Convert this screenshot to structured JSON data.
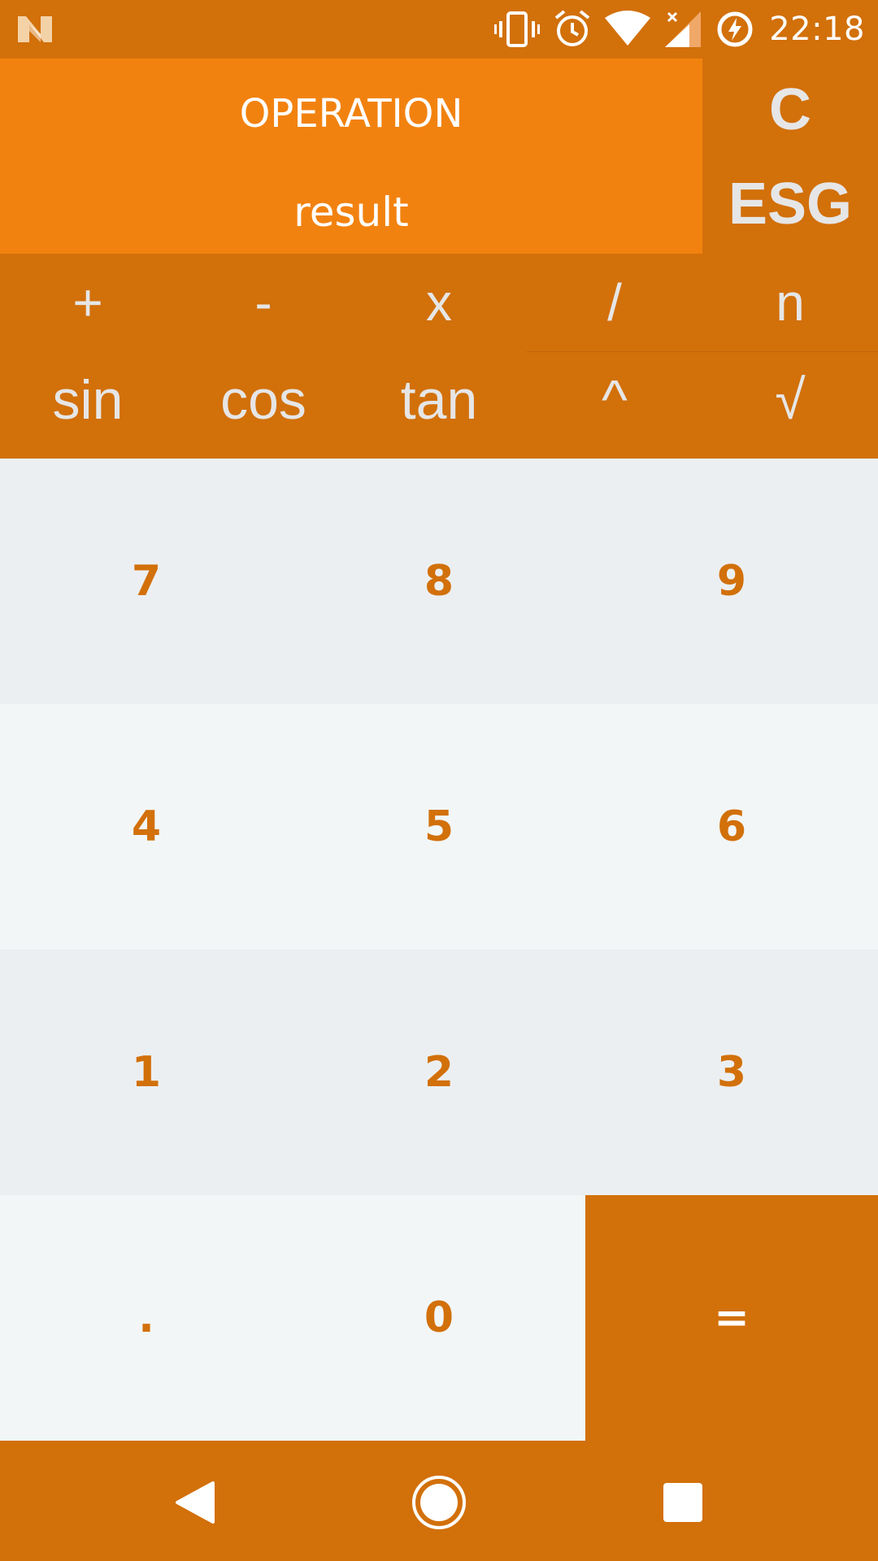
{
  "status_bar": {
    "time": "22:18",
    "icons": [
      "n-logo-icon",
      "vibrate-icon",
      "alarm-icon",
      "wifi-icon",
      "signal-icon",
      "battery-charging-icon"
    ]
  },
  "display": {
    "operation": "OPERATION",
    "result": "result"
  },
  "side_panel": {
    "clear_label": "C",
    "esg_label": "ESG"
  },
  "advanced": {
    "row1": [
      "+",
      "-",
      "x",
      "/",
      "n"
    ],
    "row2": [
      "sin",
      "cos",
      "tan",
      "^",
      "√"
    ]
  },
  "numpad": {
    "row0": [
      "7",
      "8",
      "9"
    ],
    "row1": [
      "4",
      "5",
      "6"
    ],
    "row2": [
      "1",
      "2",
      "3"
    ],
    "row3": [
      ".",
      "0",
      "="
    ]
  },
  "nav": {
    "icons": [
      "back-icon",
      "home-icon",
      "recents-icon"
    ]
  },
  "colors": {
    "primary": "#d2700a",
    "display": "#f2820f",
    "pad_light": "#f2f6f7",
    "pad_dark": "#eceff1"
  }
}
